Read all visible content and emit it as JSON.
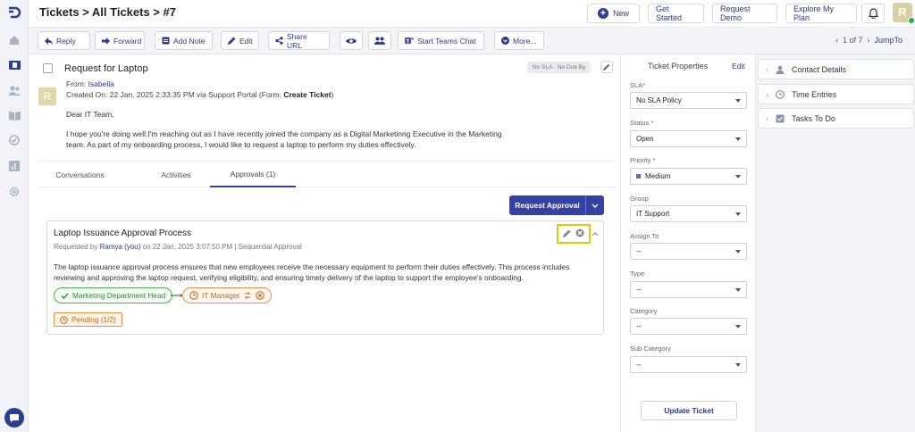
{
  "header": {
    "breadcrumb": "Tickets > All Tickets > #7",
    "new_label": "New",
    "get_started_label": "Get Started",
    "request_demo_label": "Request Demo",
    "explore_plan_label": "Explore My Plan",
    "avatar_letter": "R"
  },
  "toolbar": {
    "reply": "Reply",
    "forward": "Forward",
    "add_note": "Add Note",
    "edit": "Edit",
    "share_url": "Share URL",
    "teams_chat": "Start Teams Chat",
    "more": "More...",
    "pager": "1 of 7",
    "jump_to": "JumpTo"
  },
  "ticket": {
    "subject": "Request for Laptop",
    "sla_badge": "No SLA · No Due By",
    "from_label": "From: ",
    "requester": "Isabella",
    "requester_initial": "R",
    "created_prefix": "Created On: 22 Jan, 2025 2:33:35 PM via Support Portal (Form: ",
    "created_form": "Create Ticket",
    "created_suffix": ")",
    "greeting": "Dear IT Team,",
    "message": "I hope you're doing well.I'm reaching out as I have recently joined the company as a Digital Marketinng Executive in the Marketing team. As part of my onboarding process, I would like to request a laptop to perform my duties effectively."
  },
  "tabs": {
    "conversations": "Conversations",
    "activities": "Activities",
    "approvals": "Approvals (1)"
  },
  "approval": {
    "request_button": "Request Approval",
    "title": "Laptop Issuance Approval Process",
    "meta_prefix": "Requested by ",
    "meta_user": "Ramya (you)",
    "meta_suffix": " on 22 Jan, 2025 3:07:50 PM | Sequential Approval",
    "description": "The laptop issuance approval process ensures that new employees receive the necessary equipment to perform their duties effectively. This process includes reviewing and approving the laptop request, verifying eligibility, and ensuring timely delivery of the laptop to support the employee's onboarding.",
    "step1": "Marketing Department Head",
    "step2": "IT Manager",
    "status": "Pending (1/2)"
  },
  "properties": {
    "heading": "Ticket Properties",
    "edit": "Edit",
    "sla_label": "SLA*",
    "sla_value": "No SLA Policy",
    "status_label": "Status *",
    "status_value": "Open",
    "priority_label": "Priority *",
    "priority_value": "Medium",
    "group_label": "Group",
    "group_value": "IT Support",
    "assign_label": "Assign To",
    "assign_value": "--",
    "type_label": "Type",
    "type_value": "--",
    "category_label": "Category",
    "category_value": "--",
    "subcategory_label": "Sub Category",
    "subcategory_value": "--",
    "update_button": "Update Ticket"
  },
  "side_panels": {
    "contact": "Contact Details",
    "time": "Time Entries",
    "tasks": "Tasks To Do"
  },
  "colors": {
    "brand": "#2c3e91",
    "primary_button": "#3342a3",
    "approved": "#4caf50",
    "pending": "#e39245",
    "highlight": "#f2c200"
  }
}
